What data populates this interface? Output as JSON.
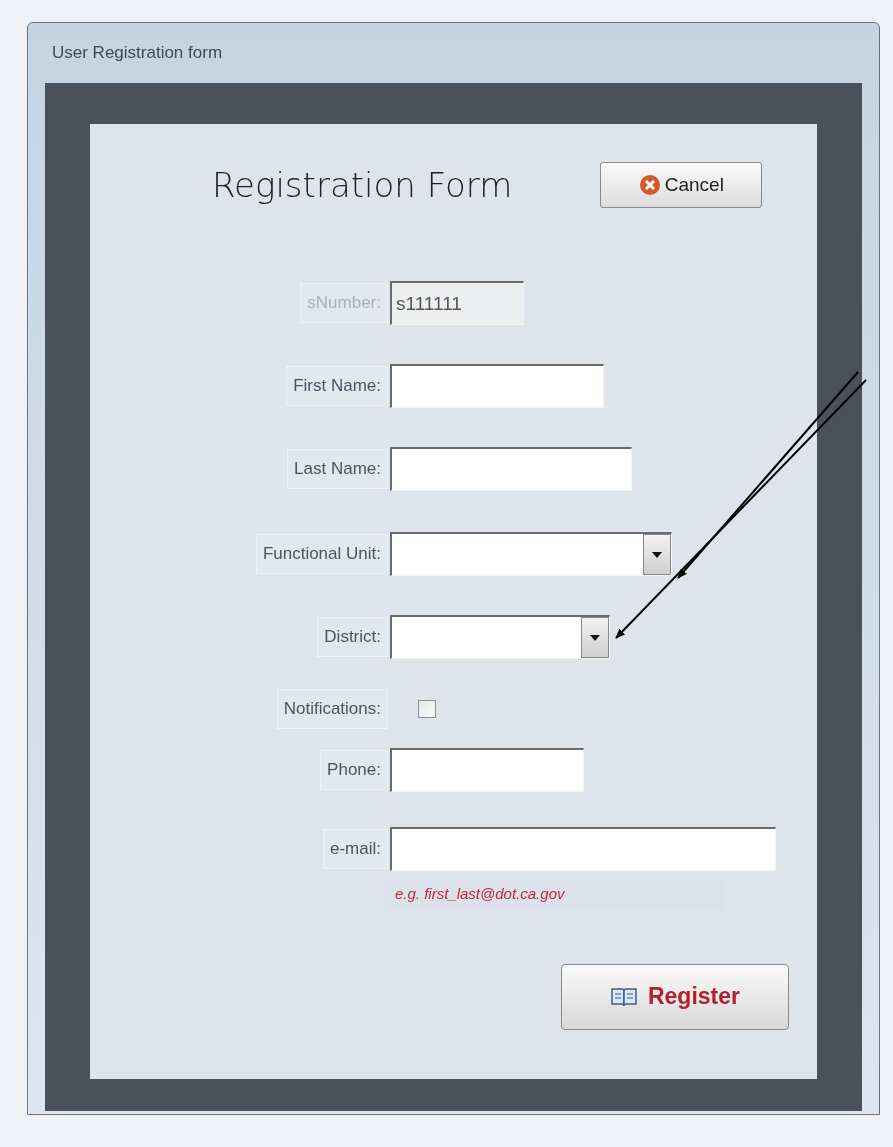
{
  "window": {
    "title": "User Registration form"
  },
  "heading": "Registration Form",
  "cancel_button": {
    "label": "Cancel"
  },
  "fields": [
    {
      "label": "sNumber:",
      "kind": "text",
      "disabled": true,
      "value": "s111111"
    },
    {
      "label": "First Name:",
      "kind": "text",
      "disabled": false
    },
    {
      "label": "Last Name:",
      "kind": "text",
      "disabled": false
    },
    {
      "label": "Functional Unit:",
      "kind": "dropdown",
      "disabled": false
    },
    {
      "label": "District:",
      "kind": "dropdown",
      "disabled": false
    },
    {
      "label": "Notifications:",
      "kind": "checkbox",
      "disabled": false,
      "checked": false
    },
    {
      "label": "Phone:",
      "kind": "text",
      "disabled": false
    },
    {
      "label": "e-mail:",
      "kind": "text",
      "disabled": false
    }
  ],
  "email_hint": "e.g.  first_last@dot.ca.gov",
  "register_button": {
    "label": "Register"
  }
}
